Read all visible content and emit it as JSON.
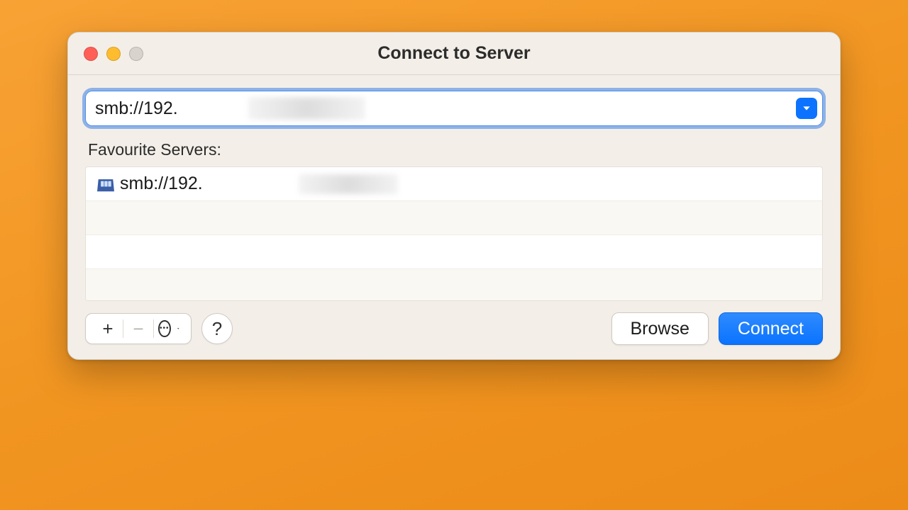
{
  "window": {
    "title": "Connect to Server"
  },
  "traffic_lights": {
    "close": "close",
    "minimize": "minimize",
    "zoom": "zoom-disabled"
  },
  "address": {
    "value": "smb://192.",
    "obscured_suffix": true
  },
  "sections": {
    "favourites_label": "Favourite Servers:"
  },
  "favourites": [
    {
      "icon": "network-server-icon",
      "label": "smb://192.",
      "obscured_suffix": true
    }
  ],
  "toolbar": {
    "add": "+",
    "remove": "−",
    "actions": "more",
    "help": "?"
  },
  "buttons": {
    "browse": "Browse",
    "connect": "Connect"
  },
  "colors": {
    "accent": "#0a73ff",
    "background": "#f3efe8",
    "desktop": "#f19521"
  }
}
